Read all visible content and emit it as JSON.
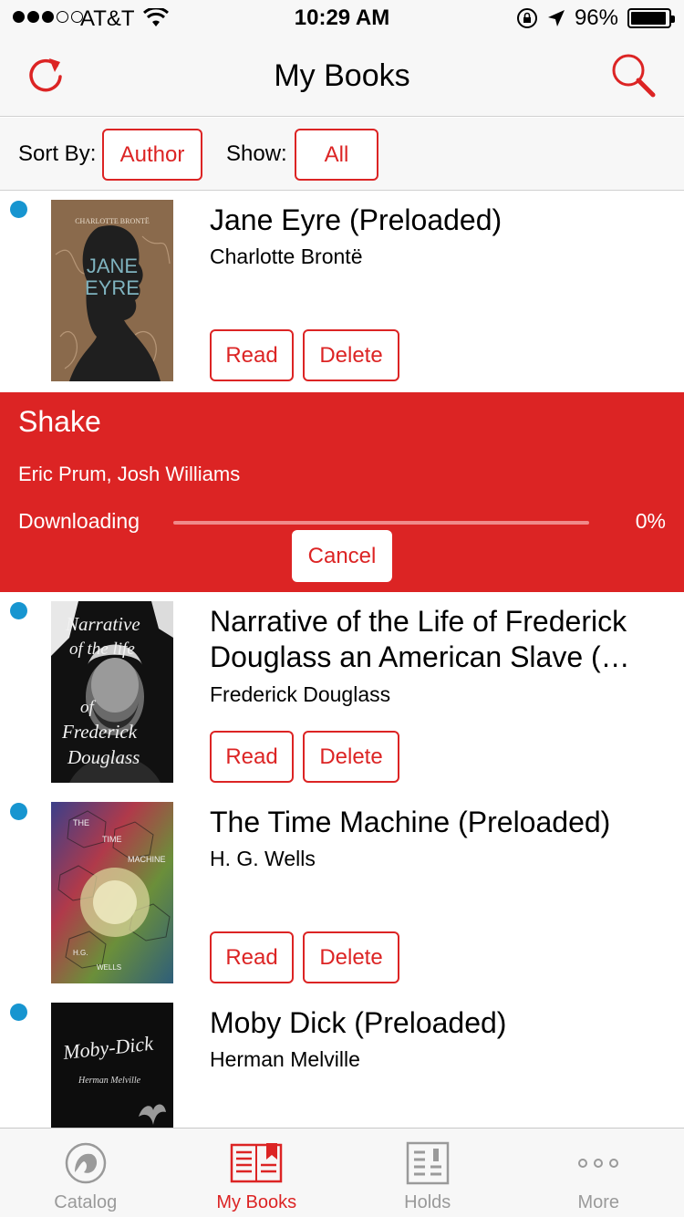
{
  "status_bar": {
    "carrier": "AT&T",
    "time": "10:29 AM",
    "battery": "96%",
    "battery_level": 0.96,
    "signal_bars_filled": 3,
    "signal_bars_total": 5
  },
  "nav": {
    "title": "My Books",
    "left_icon": "refresh-icon",
    "right_icon": "search-icon"
  },
  "sort_bar": {
    "sort_label": "Sort By:",
    "sort_value": "Author",
    "show_label": "Show:",
    "show_value": "All"
  },
  "books": [
    {
      "title": "Jane Eyre (Preloaded)",
      "author": "Charlotte Brontë",
      "cover_text": [
        "CHARLOTTE BRONTË",
        "JANE",
        "EYRE"
      ],
      "read_label": "Read",
      "delete_label": "Delete",
      "unread": true
    },
    {
      "title": "Narrative of the Life of Frederick Douglass an American Slave (…",
      "author": "Frederick Douglass",
      "cover_text": [
        "Narrative",
        "of the life",
        "of",
        "Frederick",
        "Douglass"
      ],
      "read_label": "Read",
      "delete_label": "Delete",
      "unread": true
    },
    {
      "title": "The Time Machine (Preloaded)",
      "author": "H. G. Wells",
      "cover_text": [
        "THE",
        "TIME",
        "MACHINE",
        "H.G.",
        "WELLS"
      ],
      "read_label": "Read",
      "delete_label": "Delete",
      "unread": true
    },
    {
      "title": "Moby Dick (Preloaded)",
      "author": "Herman Melville",
      "cover_text": [
        "Moby-Dick",
        "Herman Melville"
      ],
      "unread": true
    }
  ],
  "download": {
    "title": "Shake",
    "author": "Eric Prum, Josh Williams",
    "status": "Downloading",
    "percent_label": "0%",
    "progress": 0.0,
    "cancel_label": "Cancel"
  },
  "tabs": [
    {
      "label": "Catalog",
      "icon": "lion-logo-icon",
      "active": false
    },
    {
      "label": "My Books",
      "icon": "book-bookmark-icon",
      "active": true
    },
    {
      "label": "Holds",
      "icon": "holds-list-icon",
      "active": false
    },
    {
      "label": "More",
      "icon": "more-dots-icon",
      "active": false
    }
  ],
  "colors": {
    "accent": "#dc2424",
    "unread_dot": "#1795d0",
    "bar_background": "#f7f7f7",
    "inactive_tab": "#9a9a9a"
  }
}
